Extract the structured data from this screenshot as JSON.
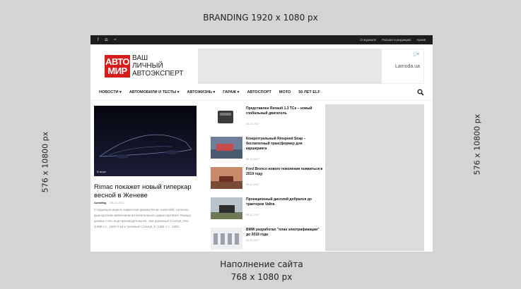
{
  "zones": {
    "top_label": "BRANDING 1920 x 1080 px",
    "left_label": "576 x 10800 px",
    "right_label": "576 x 10800 px",
    "bottom_label_1": "Наполнение сайта",
    "bottom_label_2": "768 x 1080 px"
  },
  "site": {
    "topbar": {
      "social_icons": [
        "facebook-icon",
        "instagram-icon",
        "rss-icon"
      ],
      "social_glyphs": [
        "f",
        "◘",
        "≈"
      ],
      "links": [
        "О журнале",
        "Письмо в редакцию",
        "Архив"
      ]
    },
    "logo": {
      "mark_line1": "АВТО",
      "mark_line2": "МИР",
      "line1": "ВАШ",
      "line2": "ЛИЧНЫЙ",
      "line3": "АВТОЭКСПЕРТ",
      "color": "#d81b1b"
    },
    "ad_banner": {
      "mark": "▯✕",
      "brand": "Lamoda.ua"
    },
    "nav": {
      "items": [
        "НОВОСТИ ▾",
        "АВТОМОБИЛИ И ТЕСТЫ ▾",
        "АВТОЖИЗНЬ ▾",
        "ГАРАЖ ▾",
        "АВТОСПОРТ",
        "МОТО",
        "50 ЛЕТ ELF"
      ]
    },
    "featured": {
      "tag": "В мире",
      "title": "Rimac покажет новый гиперкар весной в Женеве",
      "author": "AutoMag",
      "date": "06.12.2017",
      "excerpt": "Следующая модель хорватской фирмы Rimac Automobili, согласно французским заявлениям исполнительного директора Мате Римаца, должна стать ещё производительнее, чем дорожный Concept_One (1088 л.с., 1600 Н·м) и трековый Concept_S (1384 л.с., 1800..."
    },
    "news": [
      {
        "title": "Представлен Renault 1.3 TCe – новый глобальный двигатель",
        "date": "06.12.2017"
      },
      {
        "title": "Концептуальный Rinspeed Snap – беспилотный трансформер для каршеринга",
        "date": "06.12.2017"
      },
      {
        "title": "Ford Bronco нового поколения появиться в 2019 году",
        "date": "06.12.2017"
      },
      {
        "title": "Проекционный дисплей добрался до тракторов Valtra",
        "date": "06.12.2017"
      },
      {
        "title": "BMW разработал \"план электрификации\" до 2018 года",
        "date": "06.12.2017"
      }
    ]
  }
}
